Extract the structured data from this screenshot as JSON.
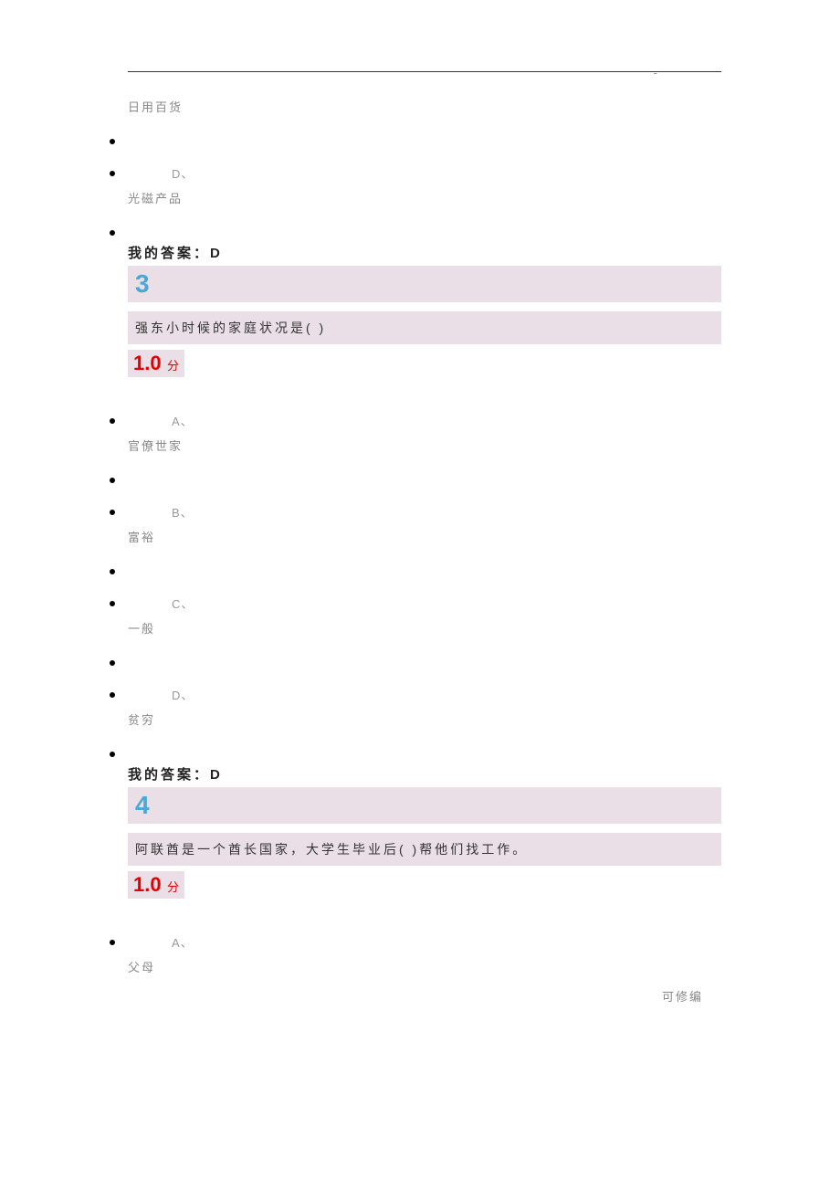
{
  "page_dash": "-",
  "prev_option_c_text": "日用百货",
  "prev_option_d_label": "D、",
  "prev_option_d_text": "光磁产品",
  "prev_my_answer": "我的答案：D",
  "q3": {
    "number": "3",
    "text": "强东小时候的家庭状况是( )",
    "score_num": "1.0",
    "score_unit": "分",
    "options": {
      "a_label": "A、",
      "a_text": "官僚世家",
      "b_label": "B、",
      "b_text": "富裕",
      "c_label": "C、",
      "c_text": "一般",
      "d_label": "D、",
      "d_text": "贫穷"
    },
    "my_answer": "我的答案：D"
  },
  "q4": {
    "number": "4",
    "text": "阿联酋是一个酋长国家，大学生毕业后( )帮他们找工作。",
    "score_num": "1.0",
    "score_unit": "分",
    "options": {
      "a_label": "A、",
      "a_text": "父母"
    }
  },
  "footer": "可修编"
}
